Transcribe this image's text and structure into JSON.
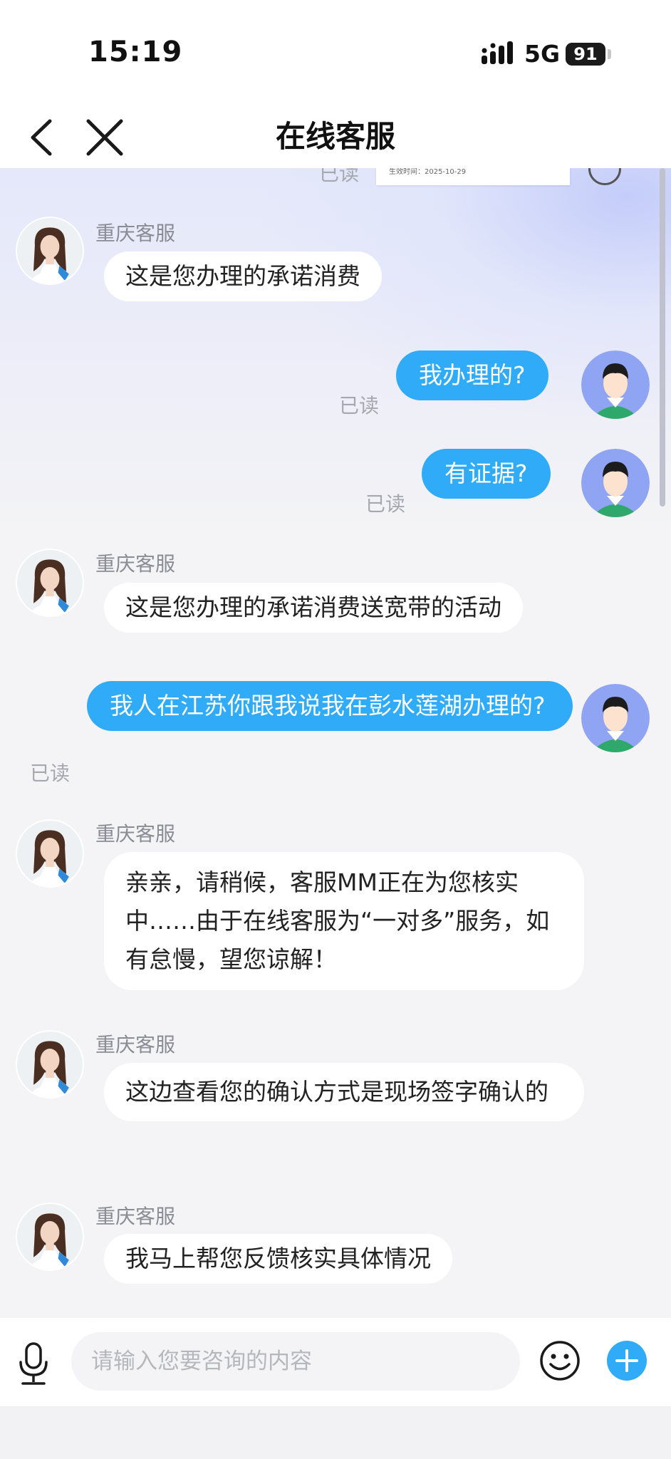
{
  "status_bar": {
    "time": "15:19",
    "network": "5G",
    "battery": "91"
  },
  "nav": {
    "title": "在线客服"
  },
  "chat": {
    "previous_read": "已读",
    "previous_image_text": "生效时间：2025-10-29",
    "messages": [
      {
        "from": "agent",
        "sender": "重庆客服",
        "text": "这是您办理的承诺消费"
      },
      {
        "from": "user",
        "text": "我办理的?",
        "status": "已读"
      },
      {
        "from": "user",
        "text": "有证据?",
        "status": "已读"
      },
      {
        "from": "agent",
        "sender": "重庆客服",
        "text": "这是您办理的承诺消费送宽带的活动"
      },
      {
        "from": "user",
        "text": "我人在江苏你跟我说我在彭水莲湖办理的?",
        "status": "已读"
      },
      {
        "from": "agent",
        "sender": "重庆客服",
        "text": "亲亲，请稍候，客服MM正在为您核实中……由于在线客服为“一对多”服务，如有怠慢，望您谅解！"
      },
      {
        "from": "agent",
        "sender": "重庆客服",
        "text": "这边查看您的确认方式是现场签字确认的"
      },
      {
        "from": "agent",
        "sender": "重庆客服",
        "text": "我马上帮您反馈核实具体情况"
      }
    ]
  },
  "input": {
    "placeholder": "请输入您要咨询的内容",
    "value": ""
  },
  "icons": {
    "back": "chevron-left-icon",
    "close": "close-icon",
    "voice": "microphone-icon",
    "emoji": "smiley-icon",
    "more": "plus-icon"
  },
  "colors": {
    "user_bubble": "#2fabf8",
    "agent_bubble": "#ffffff",
    "accent": "#2fabf8",
    "muted_text": "#a6a8b0"
  }
}
